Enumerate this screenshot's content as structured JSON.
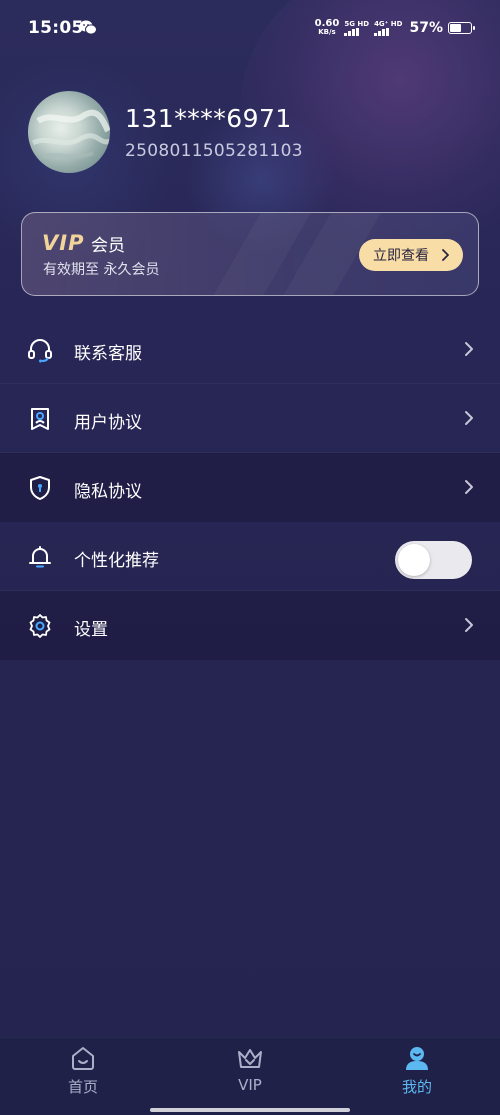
{
  "status_bar": {
    "time": "15:05",
    "net_speed": "0.60",
    "net_unit": "KB/s",
    "sim1_label": "5G HD",
    "sim2_label": "4G⁺ HD",
    "battery_percent": "57%",
    "battery_level": 0.57,
    "icons": [
      "wechat-icon",
      "signal-icon",
      "battery-icon"
    ]
  },
  "profile": {
    "phone": "131****6971",
    "user_id": "2508011505281103"
  },
  "vip_card": {
    "logo": "VIP",
    "title": "会员",
    "expire_text": "有效期至 永久会员",
    "button_label": "立即查看",
    "accent_color": "#f8dda6"
  },
  "menu": {
    "items": [
      {
        "label": "联系客服",
        "icon": "headset-icon",
        "type": "link"
      },
      {
        "label": "用户协议",
        "icon": "user-agreement-icon",
        "type": "link"
      },
      {
        "label": "隐私协议",
        "icon": "shield-icon",
        "type": "link"
      },
      {
        "label": "个性化推荐",
        "icon": "bell-icon",
        "type": "toggle",
        "value": false
      },
      {
        "label": "设置",
        "icon": "gear-icon",
        "type": "link"
      }
    ]
  },
  "tabbar": {
    "tabs": [
      {
        "label": "首页",
        "icon": "home-icon",
        "active": false
      },
      {
        "label": "VIP",
        "icon": "crown-icon",
        "active": false
      },
      {
        "label": "我的",
        "icon": "profile-icon",
        "active": true
      }
    ],
    "active_color": "#5cb8f0"
  }
}
